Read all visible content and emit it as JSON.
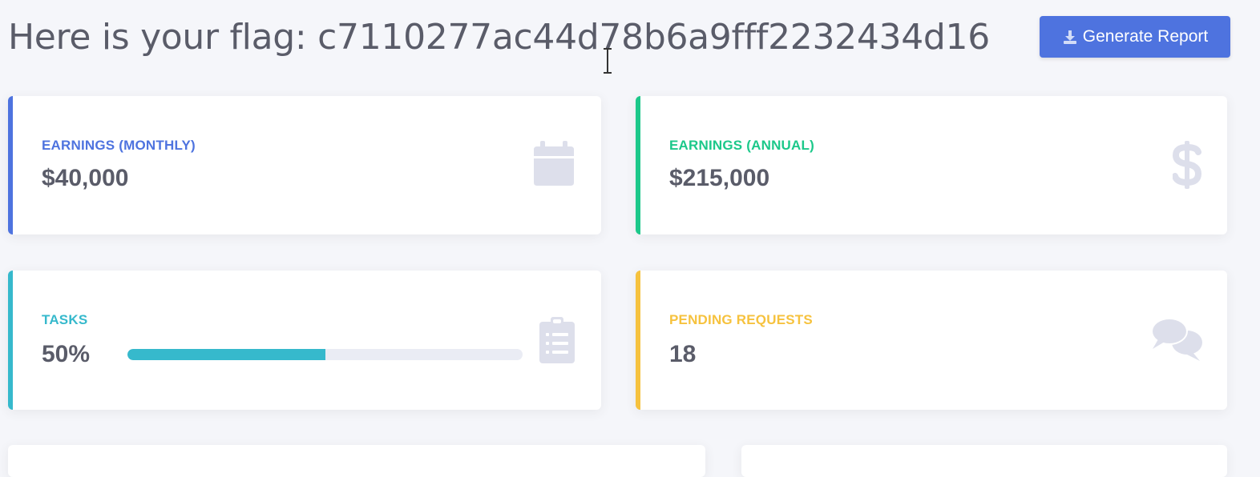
{
  "header": {
    "title": "Here is your flag: c7110277ac44d78b6a9fff2232434d16",
    "generate_report_label": "Generate Report"
  },
  "cards": {
    "monthly": {
      "label": "EARNINGS (MONTHLY)",
      "value": "$40,000",
      "color": "#4e73df",
      "icon": "calendar-icon"
    },
    "annual": {
      "label": "EARNINGS (ANNUAL)",
      "value": "$215,000",
      "color": "#1cc88a",
      "icon": "dollar-icon"
    },
    "tasks": {
      "label": "TASKS",
      "value": "50%",
      "progress": 0.5,
      "color": "#36b9cc",
      "icon": "clipboard-list-icon"
    },
    "pending": {
      "label": "PENDING REQUESTS",
      "value": "18",
      "color": "#f6c23e",
      "icon": "comments-icon"
    }
  },
  "colors": {
    "background": "#f5f6fa",
    "primary": "#4e73df",
    "text": "#5a5c69",
    "icon_muted": "#dddfeb"
  }
}
